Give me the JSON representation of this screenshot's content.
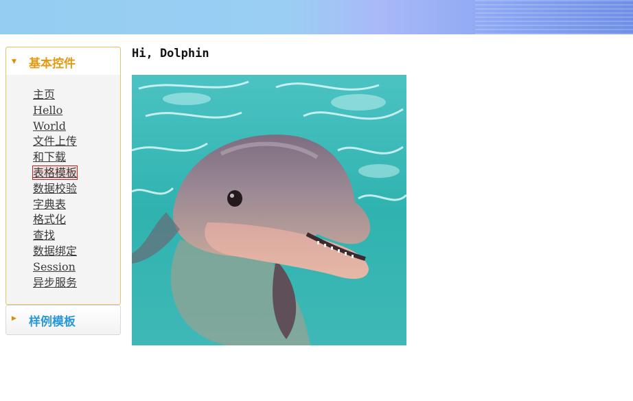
{
  "banner": {
    "colors": [
      "#94cdf2",
      "#a9b9f8",
      "#6e8fe6"
    ]
  },
  "sidebar": {
    "panels": [
      {
        "title": "基本控件",
        "expanded": true,
        "title_color": "#e39a12"
      },
      {
        "title": "样例模板",
        "expanded": false,
        "title_color": "#2a98d8"
      }
    ],
    "items": [
      {
        "label": "主页"
      },
      {
        "label": "Hello"
      },
      {
        "label": "World"
      },
      {
        "label": "文件上传"
      },
      {
        "label": "和下载"
      },
      {
        "label": "表格模板",
        "selected": true
      },
      {
        "label": "数据校验"
      },
      {
        "label": "字典表"
      },
      {
        "label": "格式化"
      },
      {
        "label": "查找"
      },
      {
        "label": "数据绑定"
      },
      {
        "label": "Session"
      },
      {
        "label": "异步服务"
      }
    ]
  },
  "main": {
    "greeting": "Hi, Dolphin",
    "image": {
      "subject": "dolphin-photo",
      "water_color": "#2fb3b0"
    }
  }
}
